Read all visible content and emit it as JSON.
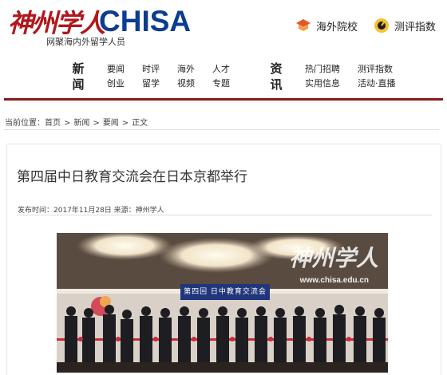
{
  "header": {
    "logo_cn": "神州学人",
    "logo_en": "CHISA",
    "tagline": "网聚海内外留学人员",
    "quick_links": [
      {
        "label": "海外院校",
        "icon": "overseas-school-icon"
      },
      {
        "label": "测评指数",
        "icon": "evaluation-index-icon"
      }
    ]
  },
  "nav": {
    "group1_title": "新闻",
    "group1_items": [
      "要闻",
      "时评",
      "海外",
      "人才",
      "创业",
      "留学",
      "视频",
      "专题"
    ],
    "group2_title": "资讯",
    "group2_items": [
      "热门招聘",
      "测评指数",
      "实用信息",
      "活动·直播"
    ]
  },
  "breadcrumb": {
    "prefix": "当前位置：",
    "items": [
      "首页",
      "新闻",
      "要闻",
      "正文"
    ],
    "sep": ">"
  },
  "article": {
    "title": "第四届中日教育交流会在日本京都举行",
    "meta": "发布时间：2017年11月28日    来源：神州学人",
    "photo": {
      "watermark_cn": "神州学人",
      "watermark_url": "www.chisa.edu.cn",
      "banner_text": "第四回 日中教育交流会"
    }
  },
  "colors": {
    "brand_red": "#b0181e",
    "brand_blue": "#0b3d91",
    "rule_red": "#8b1a1a"
  }
}
